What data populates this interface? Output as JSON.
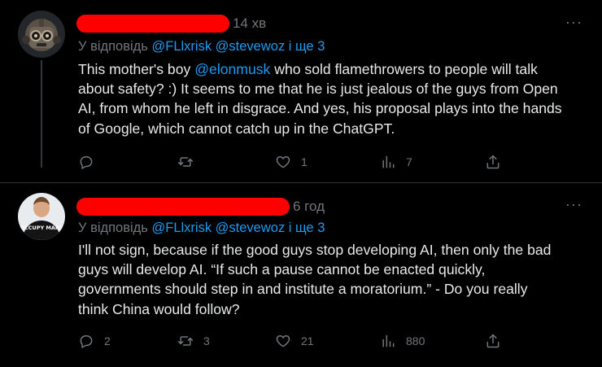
{
  "tweets": [
    {
      "time": "14 хв",
      "reply_prefix": "У відповідь",
      "reply_handles": "@FLlxrisk @stevewoz",
      "reply_suffix": "і ще 3",
      "lines": [
        [
          "This mother's boy ",
          "@elonmusk",
          " who sold flamethrowers to people will talk"
        ],
        [
          "about safety? :) It seems to me that he is just jealous of the guys from Open"
        ],
        [
          "AI, from whom he left in disgrace. And yes, his proposal plays into the hands"
        ],
        [
          "of Google, which cannot catch up in the ChatGPT."
        ]
      ],
      "stats": {
        "replies": "",
        "retweets": "",
        "likes": "1",
        "views": "7"
      }
    },
    {
      "time": "6 год",
      "reply_prefix": "У відповідь",
      "reply_handles": "@FLlxrisk @stevewoz",
      "reply_suffix": "і ще 3",
      "avatar_shirt_text": "OCCUPY MARS",
      "lines": [
        [
          "I'll not sign, because if the good guys stop developing AI, then only the bad"
        ],
        [
          "guys will develop AI. “If such a pause cannot be enacted quickly,"
        ],
        [
          "governments should step in and institute a moratorium.” - Do you really"
        ],
        [
          "think China would follow?"
        ]
      ],
      "stats": {
        "replies": "2",
        "retweets": "3",
        "likes": "21",
        "views": "880"
      }
    }
  ],
  "more_icon": "more-horizontal-icon",
  "colors": {
    "background": "#000000",
    "text": "#e7e9ea",
    "muted": "#71767b",
    "link": "#1d9bf0",
    "redaction": "#ff0000",
    "divider": "#2f3336"
  }
}
